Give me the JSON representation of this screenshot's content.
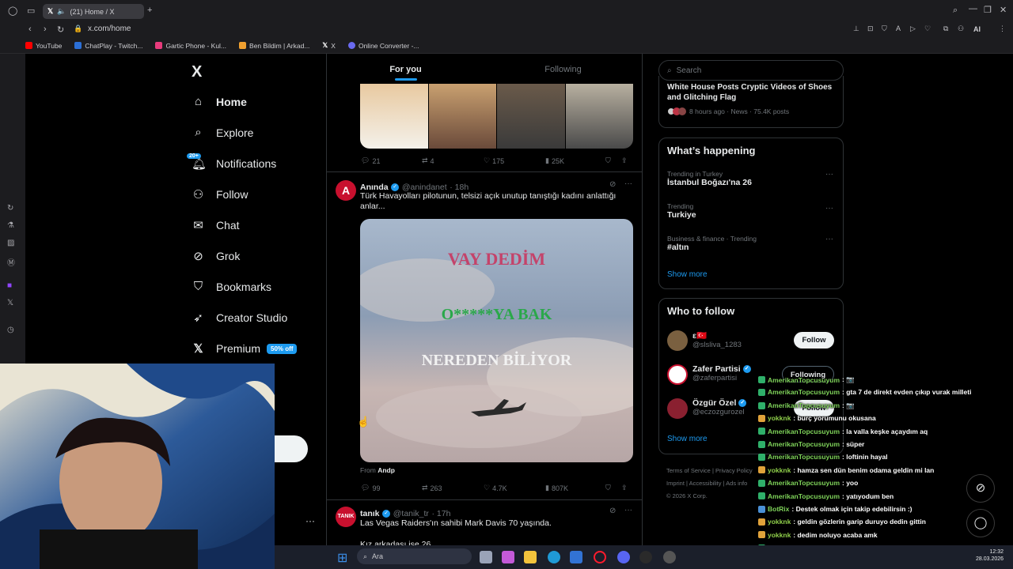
{
  "browser": {
    "tab_title": "(21) Home / X",
    "url": "x.com/home",
    "bookmarks": [
      "YouTube",
      "ChatPlay - Twitch...",
      "Gartic Phone - Kul...",
      "Ben Bildim | Arkad...",
      "X",
      "Online Converter -..."
    ],
    "ai_label": "AI"
  },
  "nav": {
    "logo": "X",
    "items": [
      {
        "label": "Home",
        "icon": "home-icon"
      },
      {
        "label": "Explore",
        "icon": "search-icon"
      },
      {
        "label": "Notifications",
        "icon": "bell-icon",
        "badge": "20+"
      },
      {
        "label": "Follow",
        "icon": "person-add-icon"
      },
      {
        "label": "Chat",
        "icon": "mail-icon"
      },
      {
        "label": "Grok",
        "icon": "grok-icon"
      },
      {
        "label": "Bookmarks",
        "icon": "bookmark-icon"
      },
      {
        "label": "Creator Studio",
        "icon": "rocket-icon"
      },
      {
        "label": "Premium",
        "icon": "x-icon",
        "badge": "50% off"
      }
    ]
  },
  "feed": {
    "tabs": [
      "For you",
      "Following"
    ],
    "tweet1": {
      "replies": "21",
      "retweets": "4",
      "likes": "175",
      "views": "25K"
    },
    "tweet2": {
      "name": "Anında",
      "handle": "@anindanet",
      "time": "· 18h",
      "text": "Türk Havayolları pilotunun, telsizi açık unutup tanıştığı kadını anlattığı anlar...",
      "video_lines": [
        "VAY DEDİM",
        "O*****YA BAK",
        "NEREDEN BİLİYOR"
      ],
      "source_prefix": "From",
      "source": "Andp",
      "replies": "99",
      "retweets": "263",
      "likes": "4.7K",
      "views": "807K"
    },
    "tweet3": {
      "name": "tanık",
      "handle": "@tanik_tr",
      "time": "· 17h",
      "text": "Las Vegas Raiders'ın sahibi Mark Davis 70 yaşında.",
      "text2": "Kız arkadaşı ise 26"
    }
  },
  "sidebar": {
    "search_placeholder": "Search",
    "news": {
      "title": "White House Posts Cryptic Videos of Shoes and Glitching Flag",
      "meta": "8 hours ago · News · 75.4K posts"
    },
    "happening": {
      "title": "What’s happening",
      "trends": [
        {
          "meta": "Trending in Turkey",
          "name": "İstanbul Boğazı'na 26"
        },
        {
          "meta": "Trending",
          "name": "Turkiye"
        },
        {
          "meta": "Business & finance · Trending",
          "name": "#altın"
        }
      ],
      "show_more": "Show more"
    },
    "who_to_follow": {
      "title": "Who to follow",
      "users": [
        {
          "name": "ε🇹🇷",
          "handle": "@slsliva_1283",
          "button": "Follow"
        },
        {
          "name": "Zafer Partisi",
          "handle": "@zaferpartisi",
          "button": "Following"
        },
        {
          "name": "Özgür Özel",
          "handle": "@eczozgurozel",
          "button": "Follow"
        }
      ],
      "show_more": "Show more"
    },
    "footer": [
      "Terms of Service",
      "Privacy Policy",
      "Imprint",
      "Accessibility",
      "Ads info",
      "© 2026 X Corp."
    ]
  },
  "chat": [
    {
      "user": "AmerikanTopcusuyum",
      "msg": ": 📷"
    },
    {
      "user": "AmerikanTopcusuyum",
      "msg": ": gta 7 de direkt evden çıkıp vurak milleti"
    },
    {
      "user": "AmerikanTopcusuyum",
      "msg": ": 📷"
    },
    {
      "user": "yokknk",
      "msg": ": burç yorumunu okusana"
    },
    {
      "user": "AmerikanTopcusuyum",
      "msg": ": la valla keşke açaydım aq"
    },
    {
      "user": "AmerikanTopcusuyum",
      "msg": ": süper"
    },
    {
      "user": "AmerikanTopcusuyum",
      "msg": ": loftinin hayal"
    },
    {
      "user": "yokknk",
      "msg": ": hamza sen dün benim odama geldin mi lan"
    },
    {
      "user": "AmerikanTopcusuyum",
      "msg": ": yoo"
    },
    {
      "user": "AmerikanTopcusuyum",
      "msg": ": yatıyodum ben"
    },
    {
      "user": "BotRix",
      "msg": ": Destek olmak için takip edebilirsin :)"
    },
    {
      "user": "yokknk",
      "msg": ": geldin gözlerin garip duruyo dedin gittin"
    },
    {
      "user": "yokknk",
      "msg": ": dedim noluyo acaba amk"
    },
    {
      "user": "AmerikanTopcusuyum",
      "msg": ": 📷"
    },
    {
      "user": "yokknk",
      "msg": ": ehe"
    }
  ],
  "taskbar": {
    "search_placeholder": "Ara",
    "time": "12:32",
    "date": "28.03.2026"
  },
  "colors": {
    "accent": "#1d9bf0",
    "chat_user_a": "#7fd35a",
    "chat_user_b": "#8fcf4a",
    "badge_green": "#00ba7c"
  }
}
